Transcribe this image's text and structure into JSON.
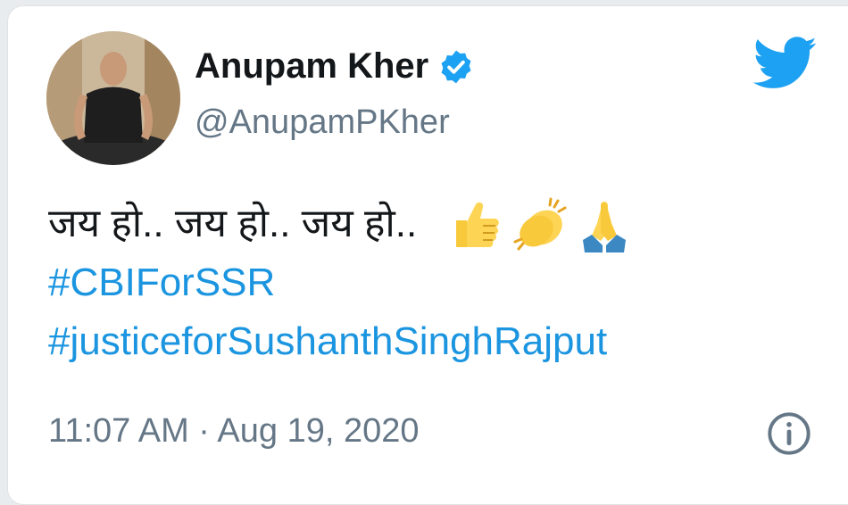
{
  "user": {
    "name": "Anupam Kher",
    "handle": "@AnupamPKher",
    "verified": true
  },
  "tweet": {
    "text": "जय हो.. जय हो.. जय हो..",
    "emojis": [
      "thumbs-up",
      "clapping-hands",
      "folded-hands"
    ],
    "hashtags": [
      "#CBIForSSR",
      "#justiceforSushanthSinghRajput"
    ]
  },
  "meta": {
    "time": "11:07 AM",
    "separator": "·",
    "date": "Aug 19, 2020"
  },
  "colors": {
    "link": "#1b95e0",
    "twitter_blue": "#1da1f2",
    "text": "#14171a",
    "secondary": "#657786"
  },
  "icons": [
    "twitter-bird-icon",
    "verified-badge-icon",
    "info-icon"
  ]
}
